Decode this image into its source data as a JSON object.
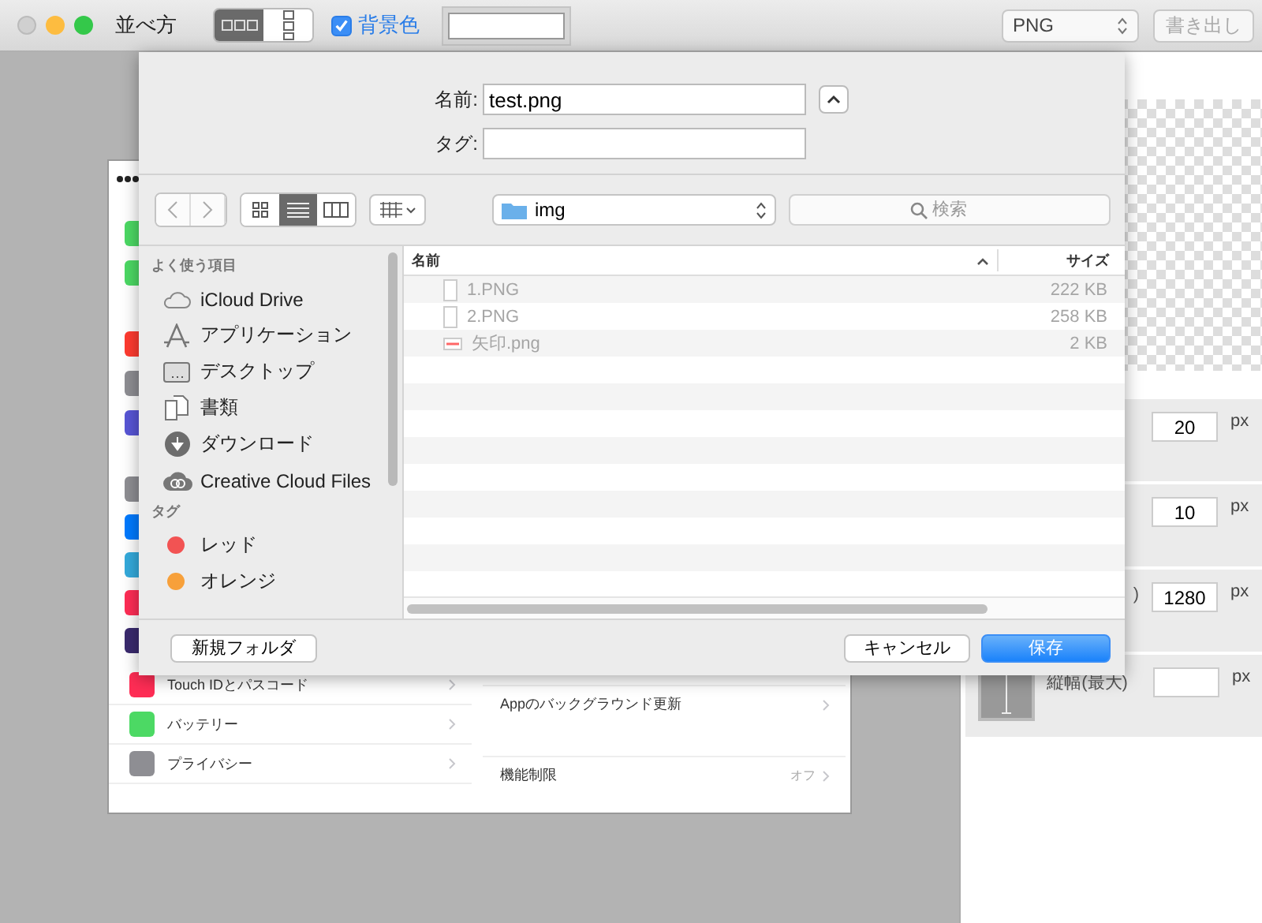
{
  "window": {
    "title": "並べ方"
  },
  "toolbar": {
    "layout_segments": [
      {
        "kind": "horizontal",
        "selected": true
      },
      {
        "kind": "vertical",
        "selected": false
      }
    ],
    "background_checkbox": {
      "label": "背景色",
      "checked": true
    },
    "format_popup": {
      "value": "PNG"
    },
    "export_button": {
      "label": "書き出し",
      "disabled": true
    }
  },
  "preview": {
    "partly_hidden_rows": [
      {
        "color": "#4cd964"
      },
      {
        "color": "#4cd964"
      },
      {
        "color": "#ff3b30"
      },
      {
        "color": "#8e8e93"
      },
      {
        "color": "#5856d6"
      },
      {
        "color": "#8e8e93"
      },
      {
        "color": "#007aff"
      },
      {
        "color": "#34aadc"
      },
      {
        "color": "#ff2d55"
      },
      {
        "color": "#3a2a6e"
      }
    ],
    "left_rows": [
      {
        "label": "Touch IDとパスコード",
        "color": "#ff2d55"
      },
      {
        "label": "バッテリー",
        "color": "#4cd964"
      },
      {
        "label": "プライバシー",
        "color": "#8e8e93"
      }
    ],
    "right_rows": [
      {
        "label": "Appのバックグラウンド更新"
      },
      {
        "label": "機能制限",
        "value": "オフ"
      }
    ]
  },
  "settings": [
    {
      "value": "20",
      "unit": "px"
    },
    {
      "value": "10",
      "unit": "px"
    },
    {
      "label": ")",
      "value": "1280",
      "unit": "px"
    },
    {
      "kind": "height",
      "label": "縦幅(最大)",
      "unit": "px"
    }
  ],
  "save_sheet": {
    "name_label": "名前:",
    "name_value": "test.png",
    "tags_label": "タグ:",
    "view_modes": [
      {
        "kind": "icons",
        "selected": false
      },
      {
        "kind": "list",
        "selected": true
      },
      {
        "kind": "columns",
        "selected": false
      }
    ],
    "location": "img",
    "search_placeholder": "検索",
    "sidebar": [
      {
        "title": "よく使う項目",
        "items": [
          {
            "kind": "cloud",
            "label": "iCloud Drive"
          },
          {
            "kind": "apps",
            "label": "アプリケーション"
          },
          {
            "kind": "desktop",
            "label": "デスクトップ"
          },
          {
            "kind": "documents",
            "label": "書類"
          },
          {
            "kind": "download",
            "label": "ダウンロード"
          },
          {
            "kind": "creative",
            "label": "Creative Cloud Files"
          }
        ]
      },
      {
        "title": "タグ",
        "items": [
          {
            "kind": "tag",
            "label": "レッド",
            "color": "#f25353"
          },
          {
            "kind": "tag",
            "label": "オレンジ",
            "color": "#f7a03a"
          }
        ]
      }
    ],
    "columns": [
      {
        "label": "名前",
        "sorted": true
      },
      {
        "label": "サイズ",
        "sorted": false
      }
    ],
    "files": [
      {
        "kind": "document",
        "name": "1.PNG",
        "size": "222 KB",
        "disabled": true
      },
      {
        "kind": "document",
        "name": "2.PNG",
        "size": "258 KB",
        "disabled": true
      },
      {
        "kind": "arrow-image",
        "name": "矢印.png",
        "size": "2 KB",
        "disabled": true
      }
    ],
    "buttons": {
      "new_folder": "新規フォルダ",
      "cancel": "キャンセル",
      "save": "保存"
    }
  }
}
